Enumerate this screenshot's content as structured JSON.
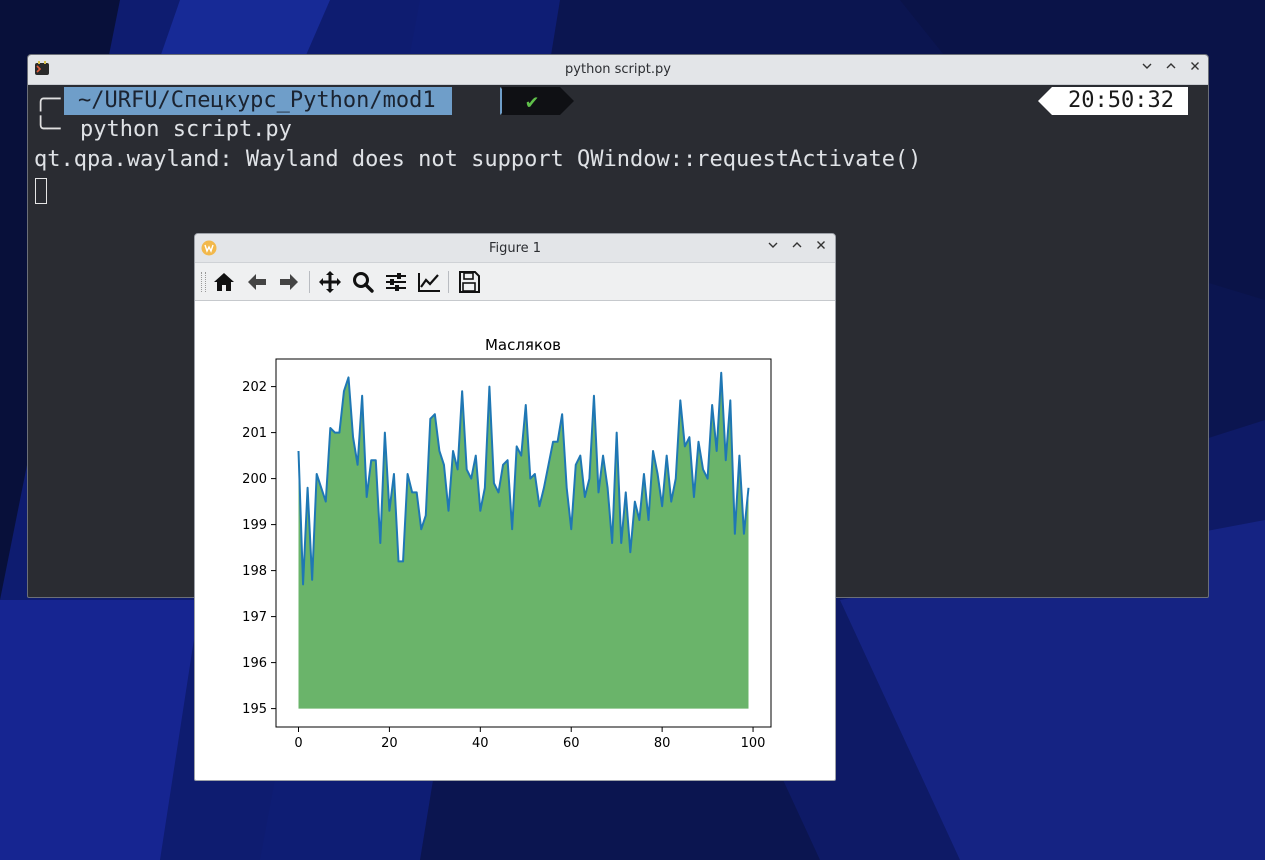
{
  "terminal": {
    "title": "python script.py",
    "prompt_path": "~/URFU/Спецкурс_Python/mod1",
    "prompt_status": "✔",
    "clock": "20:50:32",
    "command": "python script.py",
    "output_line": "qt.qpa.wayland: Wayland does not support QWindow::requestActivate()",
    "prompt_corner_top": "╭─",
    "prompt_corner_bottom": "╰─"
  },
  "figure_window": {
    "title": "Figure 1",
    "toolbar": [
      "home-icon",
      "back-arrow-icon",
      "forward-arrow-icon",
      "move-icon",
      "zoom-icon",
      "configure-subplots-icon",
      "edit-axis-icon",
      "save-icon"
    ]
  },
  "colors": {
    "line": "#1f77b4",
    "fill": "#6ab46a",
    "path_segment": "#6f9ec9"
  },
  "chart_data": {
    "type": "area",
    "title": "Масляков",
    "xlabel": "",
    "ylabel": "",
    "xlim": [
      -4.95,
      103.95
    ],
    "ylim": [
      194.6,
      202.6
    ],
    "xticks": [
      0,
      20,
      40,
      60,
      80,
      100
    ],
    "yticks": [
      195,
      196,
      197,
      198,
      199,
      200,
      201,
      202
    ],
    "fill_baseline": 195,
    "x": [
      0,
      1,
      2,
      3,
      4,
      5,
      6,
      7,
      8,
      9,
      10,
      11,
      12,
      13,
      14,
      15,
      16,
      17,
      18,
      19,
      20,
      21,
      22,
      23,
      24,
      25,
      26,
      27,
      28,
      29,
      30,
      31,
      32,
      33,
      34,
      35,
      36,
      37,
      38,
      39,
      40,
      41,
      42,
      43,
      44,
      45,
      46,
      47,
      48,
      49,
      50,
      51,
      52,
      53,
      54,
      55,
      56,
      57,
      58,
      59,
      60,
      61,
      62,
      63,
      64,
      65,
      66,
      67,
      68,
      69,
      70,
      71,
      72,
      73,
      74,
      75,
      76,
      77,
      78,
      79,
      80,
      81,
      82,
      83,
      84,
      85,
      86,
      87,
      88,
      89,
      90,
      91,
      92,
      93,
      94,
      95,
      96,
      97,
      98,
      99
    ],
    "y": [
      200.6,
      197.7,
      199.8,
      197.8,
      200.1,
      199.8,
      199.5,
      201.1,
      201.0,
      201.0,
      201.9,
      202.2,
      200.9,
      200.3,
      201.8,
      199.6,
      200.4,
      200.4,
      198.6,
      201.0,
      199.3,
      200.1,
      198.2,
      198.2,
      200.1,
      199.7,
      199.7,
      198.9,
      199.2,
      201.3,
      201.4,
      200.6,
      200.3,
      199.3,
      200.6,
      200.2,
      201.9,
      200.2,
      200.0,
      200.5,
      199.3,
      199.8,
      202.0,
      199.9,
      199.7,
      200.3,
      200.4,
      198.9,
      200.7,
      200.5,
      201.6,
      200.0,
      200.1,
      199.4,
      199.8,
      200.3,
      200.8,
      200.8,
      201.4,
      199.8,
      198.9,
      200.3,
      200.5,
      199.6,
      200.0,
      201.8,
      199.7,
      200.5,
      199.8,
      198.6,
      201.0,
      198.6,
      199.7,
      198.4,
      199.5,
      199.1,
      200.1,
      199.1,
      200.6,
      200.1,
      199.4,
      200.5,
      199.5,
      200.0,
      201.7,
      200.7,
      200.9,
      199.6,
      200.8,
      200.2,
      200.0,
      201.6,
      200.6,
      202.3,
      200.4,
      201.7,
      198.8,
      200.5,
      198.8,
      199.8
    ]
  }
}
